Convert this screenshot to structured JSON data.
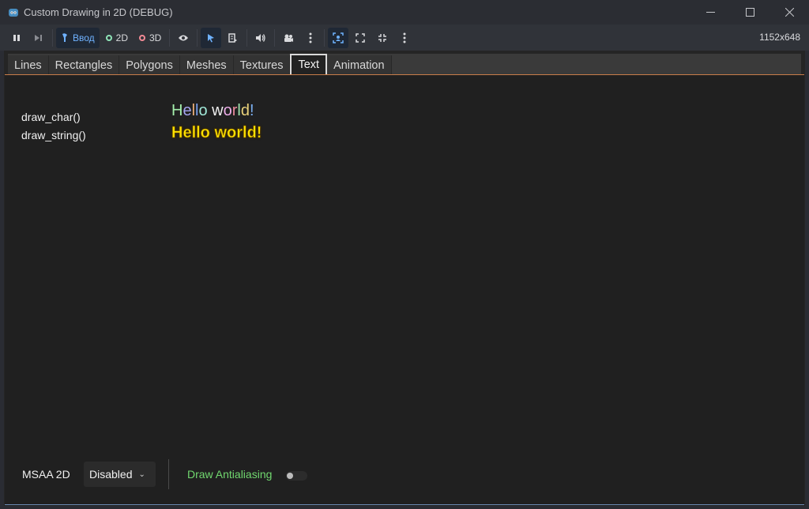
{
  "window": {
    "title": "Custom Drawing in 2D (DEBUG)",
    "controls": [
      "minimize-icon",
      "maximize-icon",
      "close-icon"
    ]
  },
  "toolbar": {
    "input_label": "Ввод",
    "mode_2d_label": "2D",
    "mode_3d_label": "3D",
    "resolution": "1152x648",
    "icons": [
      "pause-icon",
      "step-icon",
      "input-icon",
      "eye-icon",
      "select-arrow-icon",
      "list-icon",
      "speaker-icon",
      "camera-icon",
      "more-vertical-icon",
      "screen-target-icon",
      "fullscreen-icon",
      "shrink-icon",
      "more-vertical-icon"
    ]
  },
  "tabs": [
    {
      "label": "Lines"
    },
    {
      "label": "Rectangles"
    },
    {
      "label": "Polygons"
    },
    {
      "label": "Meshes"
    },
    {
      "label": "Textures"
    },
    {
      "label": "Text"
    },
    {
      "label": "Animation"
    }
  ],
  "selected_tab": "Text",
  "text_demo": {
    "draw_char_label": "draw_char()",
    "draw_string_label": "draw_string()",
    "draw_char_sample": "Hello world!",
    "draw_string_sample": "Hello world!",
    "char_colors": [
      "#a5efac",
      "#a5a5ef",
      "#ecaf79",
      "#7aa0ef",
      "#a0e8d8",
      "#f0f0f0",
      "#edaee9",
      "#e88a9c",
      "#a2e5b0",
      "#e8d07a",
      "#7aaef0",
      "#a5f0c0"
    ],
    "string_color": "#ffe300"
  },
  "footer": {
    "msaa_label": "MSAA 2D",
    "msaa_value": "Disabled",
    "antialiasing_label": "Draw Antialiasing",
    "antialiasing_enabled": false,
    "accent_color": "#71d86f"
  }
}
